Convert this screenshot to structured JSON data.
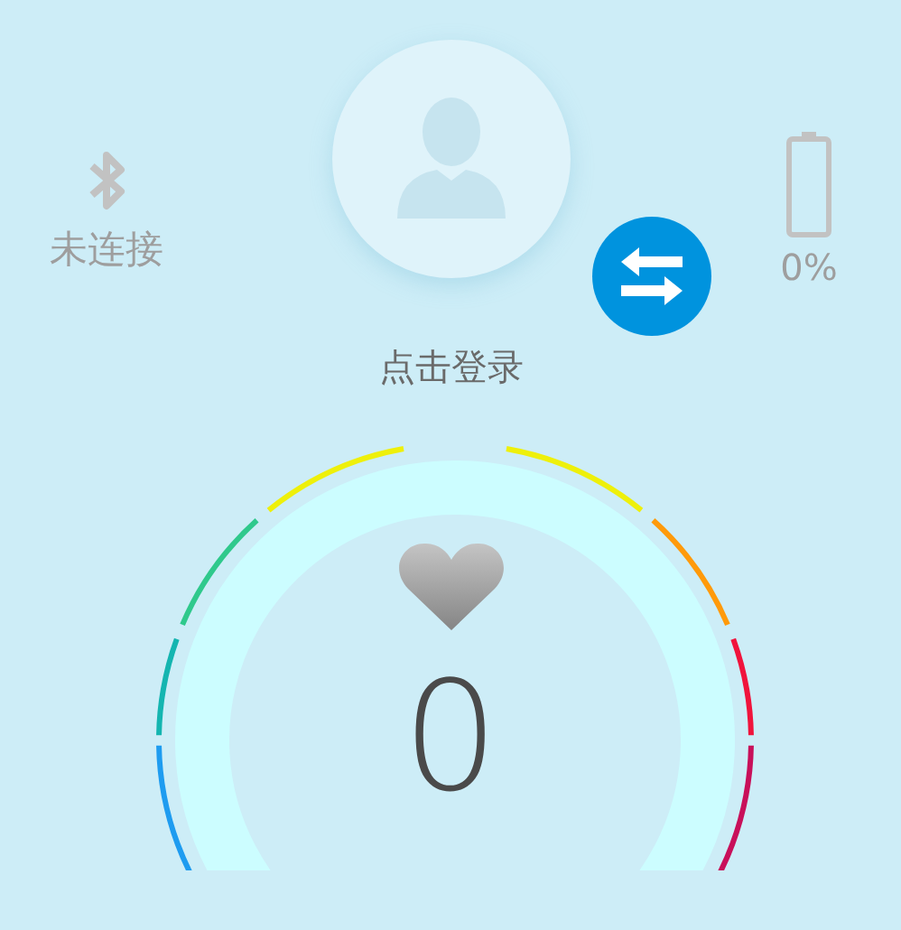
{
  "bluetooth": {
    "status": "未连接"
  },
  "login": {
    "label": "点击登录"
  },
  "battery": {
    "reading": "0%"
  },
  "heart_rate": {
    "value": "0"
  }
}
